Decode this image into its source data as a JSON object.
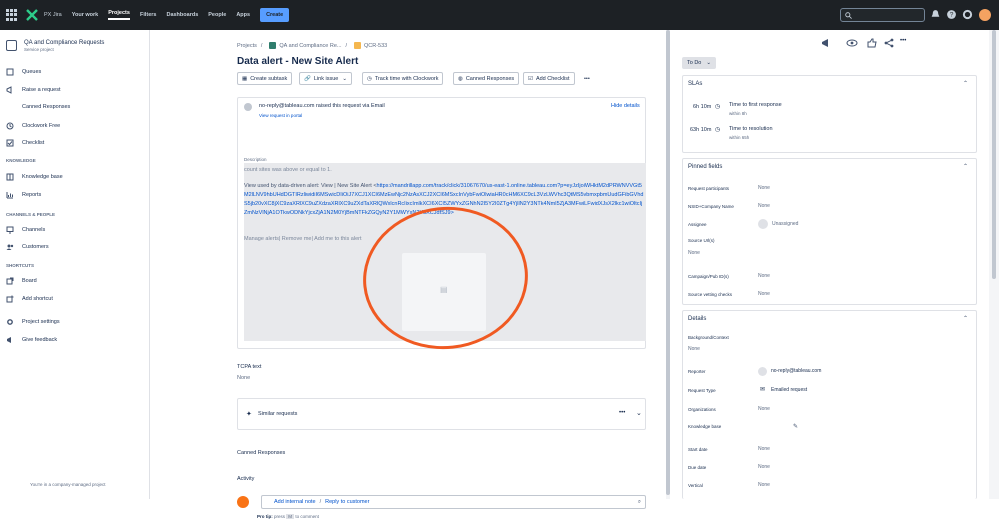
{
  "topnav": {
    "product": "PX Jira",
    "items": [
      "Your work",
      "Projects",
      "Filters",
      "Dashboards",
      "People",
      "Apps"
    ],
    "create_label": "Create"
  },
  "sidebar": {
    "project_name": "QA and Compliance Requests",
    "project_type": "Service project",
    "items": [
      "Queues",
      "Raise a request",
      "Canned Responses",
      "Clockwork Free",
      "Checklist"
    ],
    "knowledge_header": "KNOWLEDGE",
    "knowledge_items": [
      "Knowledge base",
      "Reports"
    ],
    "channels_header": "CHANNELS & PEOPLE",
    "channels_items": [
      "Channels",
      "Customers"
    ],
    "shortcuts_header": "SHORTCUTS",
    "shortcuts_items": [
      "Board",
      "Add shortcut"
    ],
    "bottom_items": [
      "Project settings",
      "Give feedback"
    ],
    "footer": "You're in a company-managed project"
  },
  "breadcrumb": {
    "root": "Projects",
    "project": "QA and Compliance Re...",
    "issue": "QCR-533"
  },
  "issue": {
    "title": "Data alert - New Site Alert",
    "toolbar": [
      "Create subtask",
      "Link issue",
      "Track time with Clockwork",
      "Canned Responses",
      "Add Checklist"
    ],
    "sender": "no-reply@tableau.com",
    "raised_text": "raised this request via Email",
    "view_in_portal": "View request in portal",
    "hide_details": "Hide details",
    "description_label": "Description",
    "desc_line1": "count sites was above or equal to 1.",
    "desc_prefix": "View used by data-driven alert: View | New Site Alert <",
    "desc_link": "https://mandrillapp.com/track/click/31067670/us-east-1.online.tableau.com?p=eyJzIjoiWHktM2dPRWNVVGt5M2lLNV9hbUHdDGTIRzliwidiI6MSwicDIiOiJ7XCJ1XCI6MzEwNjc2NzAsXCJ2XCI6MSxcInVybFwiOlwiaHR0cHM6XC9cL3VzLWVhc3QtMS5vbmxpbmUudGFibGVhdS5jb20vXC8jXC9zaXRlXC9uZXdzaXRlXC9uZXdTaXRlQWxlcnRcIixcImlkXCI6XCI5ZWYxZGNhN2I5Y2I0ZTg4YjllN2Y3NTk4NmI5ZjA3MFwiLFwidXJsX2lkc1wiOltcIjZmNzVlNjA1OTkwODNkYjcxZjA1N2M0YjBmNTFkZGQyN2Y1MWYxN2Y3XCJdfSJ9>",
    "manage_alerts": "Manage alerts| Remove me| Add me to this alert",
    "tcpa_label": "TCPA text",
    "tcpa_value": "None",
    "similar_requests": "Similar requests",
    "canned_responses": "Canned Responses",
    "activity": "Activity",
    "add_internal_note": "Add internal note",
    "separator": "/",
    "reply_to_customer": "Reply to customer",
    "pro_tip": "Pro tip:",
    "pro_tip_press": "press",
    "pro_tip_key": "M",
    "pro_tip_end": "to comment"
  },
  "right": {
    "status": "To Do",
    "slas_title": "SLAs",
    "sla": [
      {
        "time": "6h 10m",
        "name": "Time to first response",
        "within": "within 8h"
      },
      {
        "time": "63h 10m",
        "name": "Time to resolution",
        "within": "within 65h"
      }
    ],
    "pinned_title": "Pinned fields",
    "pinned": [
      {
        "label": "Request participants",
        "value": "None"
      },
      {
        "label": "NSID+Company Name",
        "value": "None"
      },
      {
        "label": "Assignee",
        "value": "Unassigned"
      },
      {
        "label": "Source Url(s)",
        "value": "None"
      },
      {
        "label": "Campaign/Pub ID(s)",
        "value": "None"
      },
      {
        "label": "Source vetting checks",
        "value": "None"
      }
    ],
    "details_title": "Details",
    "details": [
      {
        "label": "Background/Context",
        "value": "None"
      },
      {
        "label": "Reporter",
        "value": "no-reply@tableau.com"
      },
      {
        "label": "Request Type",
        "value": "Emailed request"
      },
      {
        "label": "Organizations",
        "value": "None"
      },
      {
        "label": "Knowledge base",
        "value": ""
      },
      {
        "label": "Start date",
        "value": "None"
      },
      {
        "label": "Due date",
        "value": "None"
      },
      {
        "label": "Vertical",
        "value": "None"
      }
    ]
  },
  "colors": {
    "topbar": "#1d2125",
    "accent": "#0052cc",
    "annotation": "#f05a22"
  }
}
